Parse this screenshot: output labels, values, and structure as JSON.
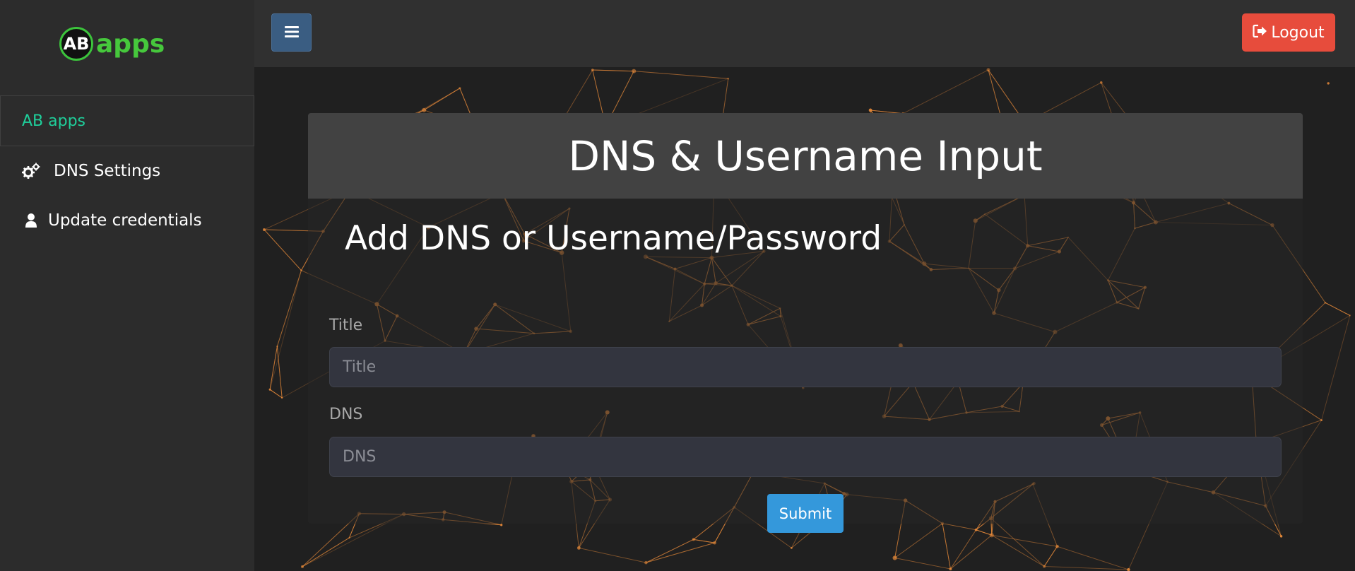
{
  "sidebar": {
    "logo": {
      "badge": "AB",
      "text": "apps"
    },
    "brand_link": "AB apps",
    "items": [
      {
        "label": "DNS Settings",
        "icon": "gears-icon"
      },
      {
        "label": "Update credentials",
        "icon": "user-icon"
      }
    ]
  },
  "header": {
    "menu_icon": "bars-icon",
    "logout_label": "Logout",
    "logout_icon": "sign-out-icon"
  },
  "card": {
    "title": "DNS & Username Input",
    "section_title": "Add DNS or Username/Password",
    "fields": [
      {
        "label": "Title",
        "placeholder": "Title",
        "value": ""
      },
      {
        "label": "DNS",
        "placeholder": "DNS",
        "value": ""
      }
    ],
    "submit_label": "Submit"
  },
  "colors": {
    "accent_blue": "#3498db",
    "logout_red": "#e74c3c",
    "brand_green": "#46c83c",
    "brand_link_teal": "#1fcf9b",
    "network_orange": "#e98b3a"
  }
}
